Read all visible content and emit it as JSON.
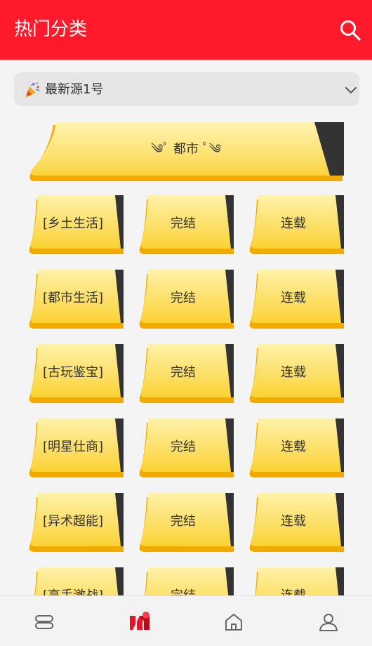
{
  "header": {
    "title": "热门分类"
  },
  "source": {
    "label": "最新源1号"
  },
  "category": {
    "label": "都市"
  },
  "rows": [
    {
      "tags": [
        "[乡土生活]",
        "完结",
        "连载"
      ]
    },
    {
      "tags": [
        "[都市生活]",
        "完结",
        "连载"
      ]
    },
    {
      "tags": [
        "[古玩鉴宝]",
        "完结",
        "连载"
      ]
    },
    {
      "tags": [
        "[明星仕商]",
        "完结",
        "连载"
      ]
    },
    {
      "tags": [
        "[异术超能]",
        "完结",
        "连载"
      ]
    },
    {
      "tags": [
        "[高手激战]",
        "完结",
        "连载"
      ]
    }
  ],
  "colors": {
    "header": "#fe1a2a",
    "tag_fill": "#fdd848",
    "tag_shadow": "#f0aa00",
    "tag_corner": "#333333"
  },
  "icons": {
    "search": "search-icon",
    "dropdown": "chevron-down-icon",
    "nav": [
      "bookshelf-icon",
      "category-icon",
      "home-icon",
      "profile-icon"
    ]
  }
}
